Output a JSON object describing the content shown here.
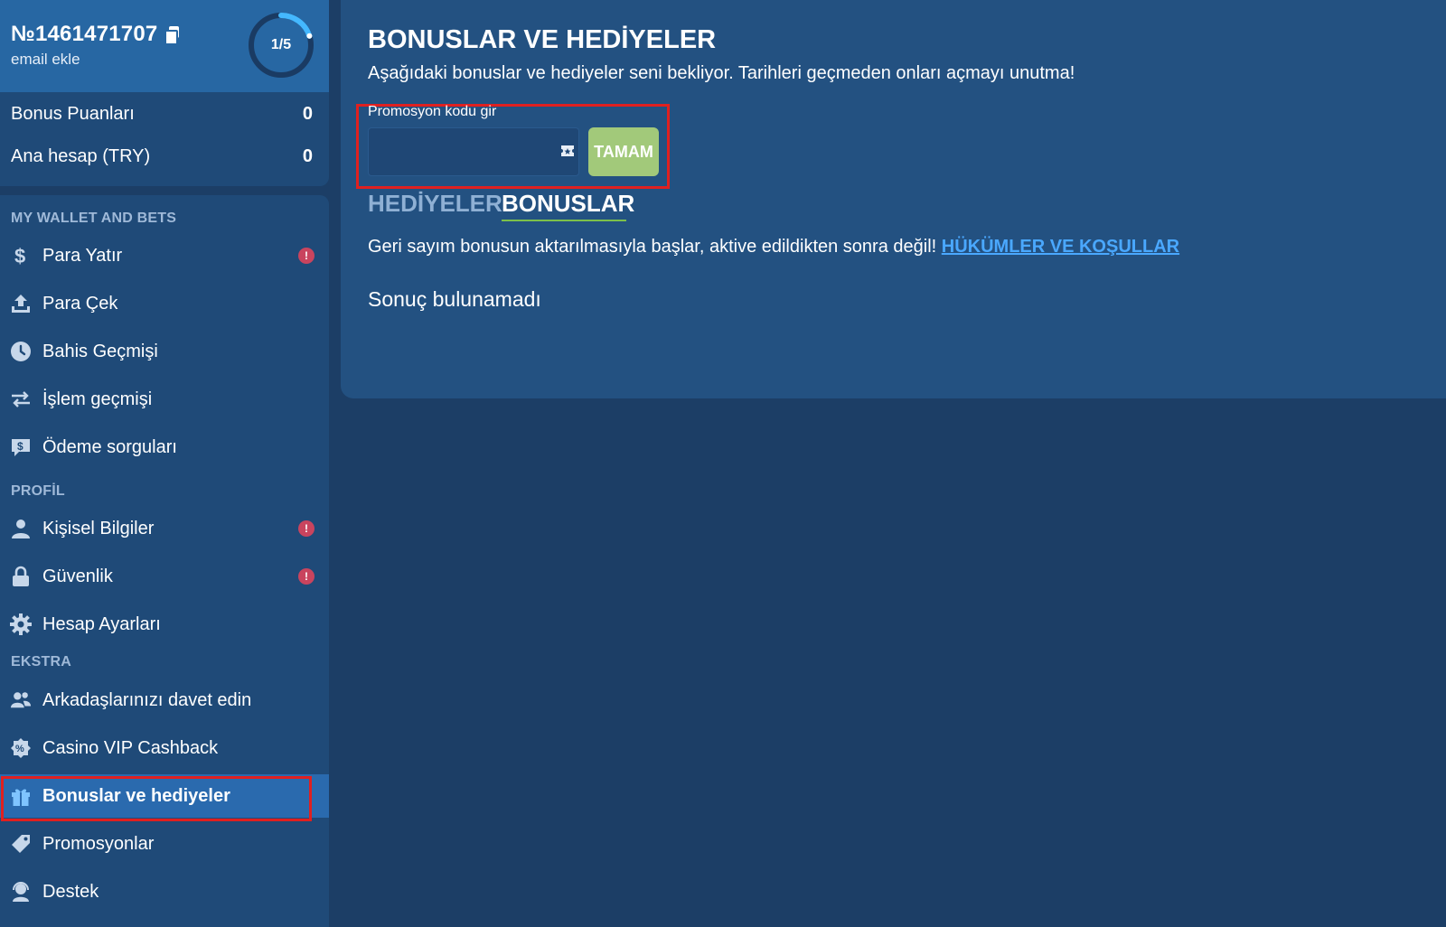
{
  "account": {
    "id": "№1461471707",
    "email_link": "email ekle",
    "progress": {
      "label": "1/5",
      "fraction": 0.2
    }
  },
  "balances": [
    {
      "label": "Bonus Puanları",
      "value": "0"
    },
    {
      "label": "Ana hesap (TRY)",
      "value": "0"
    }
  ],
  "sections": {
    "wallet": "MY WALLET AND BETS",
    "profile": "PROFİL",
    "extra": "EKSTRA"
  },
  "menu": {
    "deposit": "Para Yatır",
    "withdraw": "Para Çek",
    "bet_history": "Bahis Geçmişi",
    "transactions": "İşlem geçmişi",
    "payment_queries": "Ödeme sorguları",
    "personal_info": "Kişisel Bilgiler",
    "security": "Güvenlik",
    "account_settings": "Hesap Ayarları",
    "invite_friends": "Arkadaşlarınızı davet edin",
    "vip_cashback": "Casino VIP Cashback",
    "bonuses_gifts": "Bonuslar ve hediyeler",
    "promotions": "Promosyonlar",
    "support": "Destek"
  },
  "main": {
    "title": "BONUSLAR VE HEDİYELER",
    "subtitle": "Aşağıdaki bonuslar ve hediyeler seni bekliyor. Tarihleri geçmeden onları açmayı unutma!",
    "promo_label": "Promosyon kodu gir",
    "promo_value": "",
    "ok_button": "TAMAM",
    "tabs": [
      "HEDİYELER",
      "BONUSLAR"
    ],
    "notice_text": "Geri sayım bonusun aktarılmasıyla başlar, aktive edildikten sonra değil! ",
    "terms_link": "HÜKÜMLER VE KOŞULLAR",
    "empty": "Sonuç bulunamadı"
  },
  "colors": {
    "page_bg": "#1c3e66",
    "panel_bg": "#235181",
    "header_bg": "#2767a3",
    "accent_green": "#a2c97a",
    "link_blue": "#4aa8ff",
    "alert_red": "#c9445e",
    "highlight_red": "#e02020"
  }
}
